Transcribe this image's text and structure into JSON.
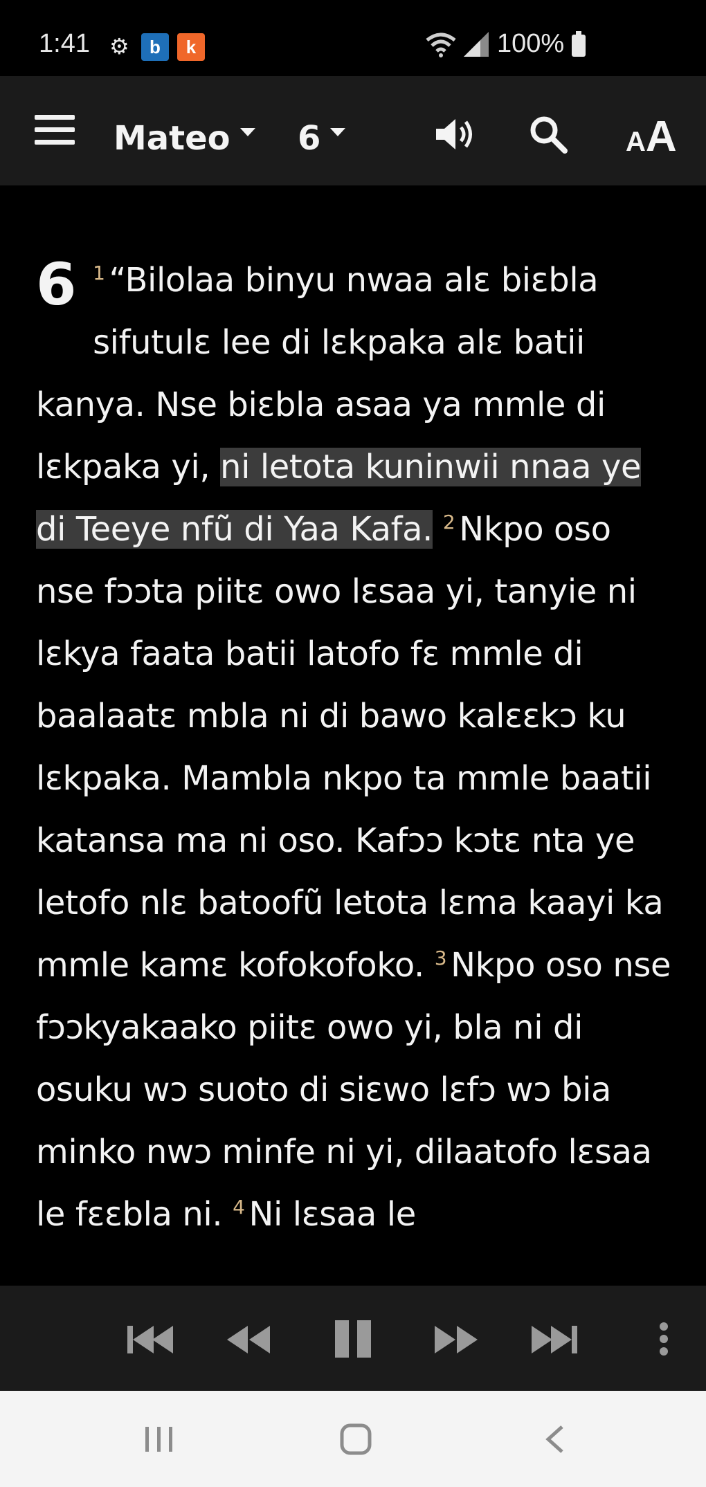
{
  "status_bar": {
    "time": "1:41",
    "battery": "100%",
    "app_badge_1": "b",
    "app_badge_2": "k"
  },
  "toolbar": {
    "book": "Mateo",
    "chapter": "6"
  },
  "reader": {
    "chapter_number": "6",
    "verses": [
      {
        "num": "1",
        "text_a": "“Bilolaa binyu nwaa alɛ biɛbla sifutulɛ lee di lɛkpaka alɛ batii kanya. Nse biɛbla asaa ya mmle di lɛkpaka yi, ",
        "text_hl": "ni letota kuninwii nnaa ye di Teeye nfũ di Yaa Kafa.",
        "text_b": " "
      },
      {
        "num": "2",
        "text": "Nkpo oso nse fɔɔta piitɛ owo lɛsaa yi, tanyie ni lɛkya faata batii latofo fɛ mmle di baalaatɛ mbla ni di bawo kalɛɛkɔ ku lɛkpaka. Mambla nkpo ta mmle baatii katansa ma ni oso. Kafɔɔ kɔtɛ nta ye letofo nlɛ batoofũ letota lɛma kaayi ka mmle kamɛ kofokofoko. "
      },
      {
        "num": "3",
        "text": "Nkpo oso nse fɔɔkyakaako piitɛ owo yi, bla ni di osuku wɔ suoto di siɛwo lɛfɔ wɔ bia minko nwɔ minfe ni yi, dilaatofo lɛsaa le fɛɛbla ni. "
      },
      {
        "num": "4",
        "text": "Ni lɛsaa le"
      }
    ]
  },
  "colors": {
    "background": "#000000",
    "toolbar": "#1b1b1b",
    "highlight": "#3c3c3c",
    "verse_number": "#d8b98a",
    "badge_blue": "#1e6fb8",
    "badge_orange": "#f0672a"
  }
}
